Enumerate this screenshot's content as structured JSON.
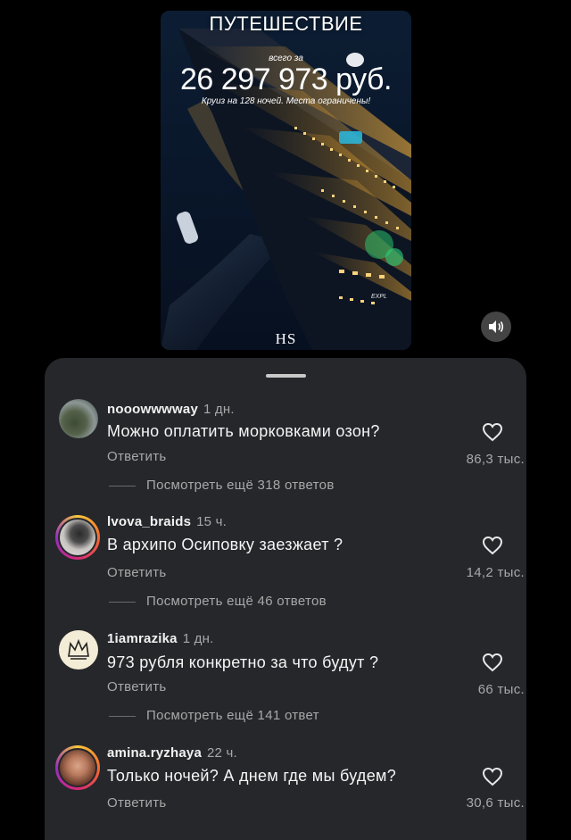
{
  "video": {
    "title_cut": "",
    "title": "ПУТЕШЕСТВИЕ",
    "price_prefix": "всего за",
    "price": "26 297 973 руб.",
    "description": "Круиз на 128 ночей. Места ограничены!",
    "logo": "HS",
    "ship_label": "EXPL"
  },
  "comments": [
    {
      "username": "nooowwwway",
      "time": "1 дн.",
      "text": "Можно оплатить морковками озон?",
      "reply_label": "Ответить",
      "likes": "86,3 тыс.",
      "more_replies": "Посмотреть ещё 318 ответов"
    },
    {
      "username": "lvova_braids",
      "time": "15 ч.",
      "text": "В архипо Осиповку заезжает ?",
      "reply_label": "Ответить",
      "likes": "14,2 тыс.",
      "more_replies": "Посмотреть ещё 46 ответов"
    },
    {
      "username": "1iamrazika",
      "time": "1 дн.",
      "text": "973 рубля конкретно за что будут ?",
      "reply_label": "Ответить",
      "likes": "66 тыс.",
      "more_replies": "Посмотреть ещё 141 ответ"
    },
    {
      "username": "amina.ryzhaya",
      "time": "22 ч.",
      "text": "Только ночей? А днем где мы будем?",
      "reply_label": "Ответить",
      "likes": "30,6 тыс."
    }
  ],
  "icons": {
    "sound": "speaker-icon",
    "like": "heart-icon"
  }
}
